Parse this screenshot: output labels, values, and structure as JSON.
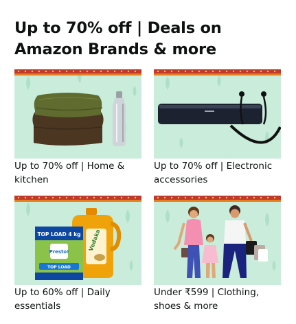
{
  "card": {
    "title": "Up to 70% off | Deals on Amazon Brands & more"
  },
  "tiles": [
    {
      "label": "Up to 70% off | Home & kitchen"
    },
    {
      "label": "Up to 70% off | Electronic accessories"
    },
    {
      "label": "Up to 60% off | Daily essentials"
    },
    {
      "label": "Under ₹599 | Clothing, shoes & more"
    }
  ],
  "product_text": {
    "detergent_top": "TOP LOAD 4 kg",
    "detergent_brand": "Presto!",
    "detergent_sub": "TOP LOAD",
    "oil_brand": "Vedaka"
  },
  "colors": {
    "tile_bg": "#c7ead9",
    "banner_red": "#c0392b",
    "banner_orange": "#e67e22",
    "text": "#0f1111"
  }
}
